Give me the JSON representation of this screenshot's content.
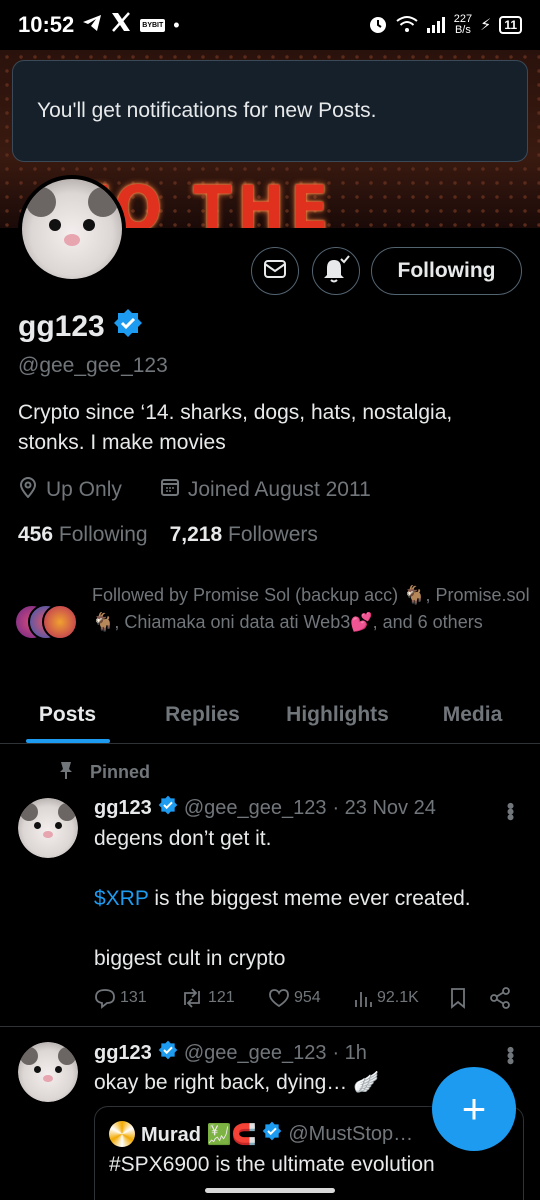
{
  "status_bar": {
    "time": "10:52",
    "left_icons": [
      "telegram-icon",
      "x-icon",
      "bybit-icon",
      "dot"
    ],
    "bybit_label": "BYBIT",
    "speed_value": "227",
    "speed_unit": "B/s",
    "battery": "11"
  },
  "toast": {
    "text": "You'll get notifications for new Posts."
  },
  "banner": {
    "text": "TO THE SHOW"
  },
  "profile": {
    "follow_state": "Following",
    "name": "gg123",
    "handle": "@gee_gee_123",
    "bio": "Crypto since ‘14. sharks, dogs, hats, nostalgia, stonks. I make movies",
    "location": "Up Only",
    "joined": "Joined August 2011",
    "following_count": "456",
    "following_label": "Following",
    "followers_count": "7,218",
    "followers_label": "Followers",
    "followed_by": "Followed by Promise Sol (backup acc) 🐐, Promise.sol 🐐, Chiamaka oni data ati Web3💕, and 6 others"
  },
  "tabs": [
    {
      "label": "Posts",
      "active": true
    },
    {
      "label": "Replies",
      "active": false
    },
    {
      "label": "Highlights",
      "active": false
    },
    {
      "label": "Media",
      "active": false
    }
  ],
  "posts": [
    {
      "pinned_label": "Pinned",
      "name": "gg123",
      "handle": "@gee_gee_123",
      "time": "· 23 Nov 24",
      "text_before": "degens don’t get it.\n\n",
      "cashtag": "$XRP",
      "text_after": " is the biggest meme ever created.\n\nbiggest cult in crypto",
      "replies": "131",
      "reposts": "121",
      "likes": "954",
      "views": "92.1K"
    },
    {
      "name": "gg123",
      "handle": "@gee_gee_123",
      "time": "· 1h",
      "text": "okay be right back, dying… 🪽",
      "quote": {
        "name": "Murad 💹🧲",
        "handle": "@MustStop…",
        "text": "#SPX6900 is the ultimate evolution"
      }
    }
  ],
  "accent_color": "#1d9bf0"
}
